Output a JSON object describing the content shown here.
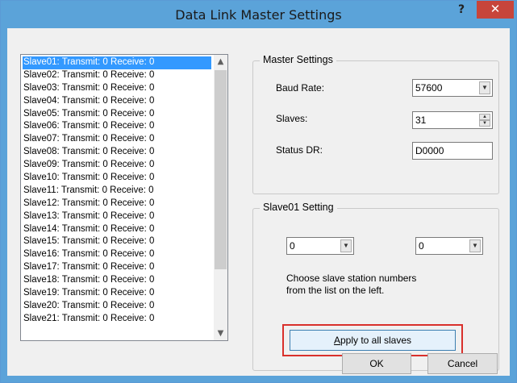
{
  "window": {
    "title": "Data Link Master Settings",
    "help": "?",
    "close": "✕"
  },
  "slave_list": [
    "Slave01: Transmit: 0 Receive: 0",
    "Slave02: Transmit: 0 Receive: 0",
    "Slave03: Transmit: 0 Receive: 0",
    "Slave04: Transmit: 0 Receive: 0",
    "Slave05: Transmit: 0 Receive: 0",
    "Slave06: Transmit: 0 Receive: 0",
    "Slave07: Transmit: 0 Receive: 0",
    "Slave08: Transmit: 0 Receive: 0",
    "Slave09: Transmit: 0 Receive: 0",
    "Slave10: Transmit: 0 Receive: 0",
    "Slave11: Transmit: 0 Receive: 0",
    "Slave12: Transmit: 0 Receive: 0",
    "Slave13: Transmit: 0 Receive: 0",
    "Slave14: Transmit: 0 Receive: 0",
    "Slave15: Transmit: 0 Receive: 0",
    "Slave16: Transmit: 0 Receive: 0",
    "Slave17: Transmit: 0 Receive: 0",
    "Slave18: Transmit: 0 Receive: 0",
    "Slave19: Transmit: 0 Receive: 0",
    "Slave20: Transmit: 0 Receive: 0",
    "Slave21: Transmit: 0 Receive: 0"
  ],
  "master": {
    "group_label": "Master Settings",
    "baud_rate_label": "Baud Rate:",
    "baud_rate_value": "57600",
    "slaves_label": "Slaves:",
    "slaves_value": "31",
    "status_dr_label": "Status DR:",
    "status_dr_value": "D0000"
  },
  "slave_setting": {
    "group_label": "Slave01 Setting",
    "transmit_value": "0",
    "receive_value": "0",
    "hint_line1": "Choose slave station numbers",
    "hint_line2": "from the list on the left.",
    "apply_prefix": "",
    "apply_underlined": "A",
    "apply_rest": "pply to all slaves"
  },
  "buttons": {
    "ok": "OK",
    "cancel": "Cancel"
  },
  "colors": {
    "titlebar": "#5ba3d9",
    "close": "#c7453b",
    "selection": "#3399ff",
    "highlight_outline": "#d9302b"
  }
}
